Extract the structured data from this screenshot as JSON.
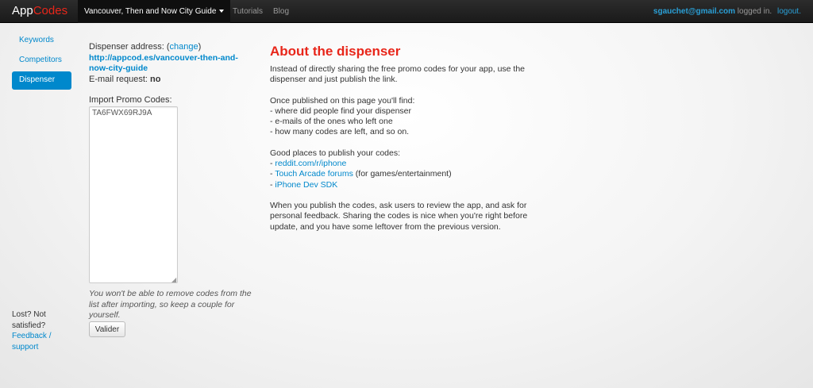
{
  "header": {
    "brand_main": "App",
    "brand_accent": "Codes",
    "app_menu": "Vancouver, Then and Now City Guide",
    "tutorials": "Tutorials",
    "blog": "Blog",
    "user_email": "sgauchet@gmail.com",
    "logged_in_text": " logged in.",
    "logout": "logout."
  },
  "sidebar": {
    "items": [
      {
        "label": "Keywords"
      },
      {
        "label": "Competitors"
      },
      {
        "label": "Dispenser"
      }
    ],
    "lost_line1": "Lost? Not",
    "lost_line2": "satisfied?",
    "feedback1": "Feedback /",
    "feedback2": "support"
  },
  "dispenser": {
    "address_label": "Dispenser address: ",
    "change_paren_open": "(",
    "change_link": "change",
    "change_paren_close": ")",
    "url_line1": "http://appcod.es/vancouver-then-and-",
    "url_line2": "now-city-guide",
    "email_request_label": "E-mail request: ",
    "email_request_value": "no",
    "import_label": "Import Promo Codes:",
    "codes_value": "TA6FWX69RJ9A",
    "help_text": "You won't be able to remove codes from the list after importing, so keep a couple for yourself.",
    "submit_label": "Valider"
  },
  "about": {
    "title": "About the dispenser",
    "intro": "Instead of directly sharing the free promo codes for your app, use the dispenser and just publish the link.",
    "find_title": "Once published on this page you'll find:",
    "find_1": "- where did people find your dispenser",
    "find_2": "- e-mails of the ones who left one",
    "find_3": "- how many codes are left, and so on.",
    "places_title": "Good places to publish your codes:",
    "dash": "- ",
    "place_1": "reddit.com/r/iphone",
    "place_2": "Touch Arcade forums",
    "place_2_suffix": " (for games/entertainment)",
    "place_3": "iPhone Dev SDK",
    "outro": "When you publish the codes, ask users to review the app, and ask for personal feedback. Sharing the codes is nice when you're right before update, and you have some leftover from the previous version."
  },
  "colors": {
    "accent_red": "#e8261a",
    "link_blue": "#0088cc",
    "navbar": "#1a1a1a"
  }
}
